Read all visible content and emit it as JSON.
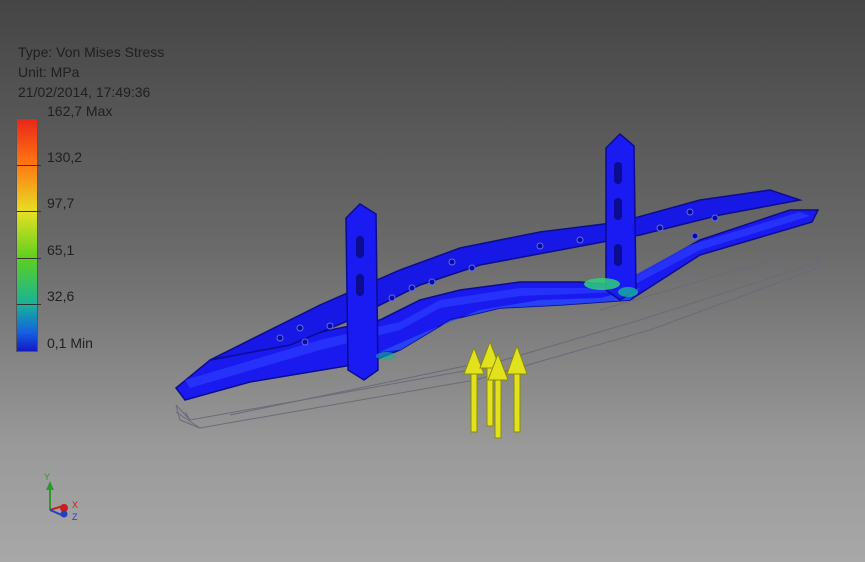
{
  "info": {
    "type_line": "Type: Von Mises Stress",
    "unit_line": "Unit: MPa",
    "timestamp": "21/02/2014, 17:49:36"
  },
  "legend": {
    "labels": [
      "162,7 Max",
      "130,2",
      "97,7",
      "65,1",
      "32,6",
      "0,1 Min"
    ],
    "colors": [
      "#e8261a",
      "#ff7a12",
      "#e6e024",
      "#5cd01f",
      "#18b29a",
      "#1418c8"
    ]
  },
  "triad": {
    "x_label": "X",
    "y_label": "Y",
    "z_label": "Z"
  },
  "colors": {
    "model_blue": "#1a1aef",
    "model_dark": "#0c0c90",
    "load_arrow": "#e2e21c"
  }
}
